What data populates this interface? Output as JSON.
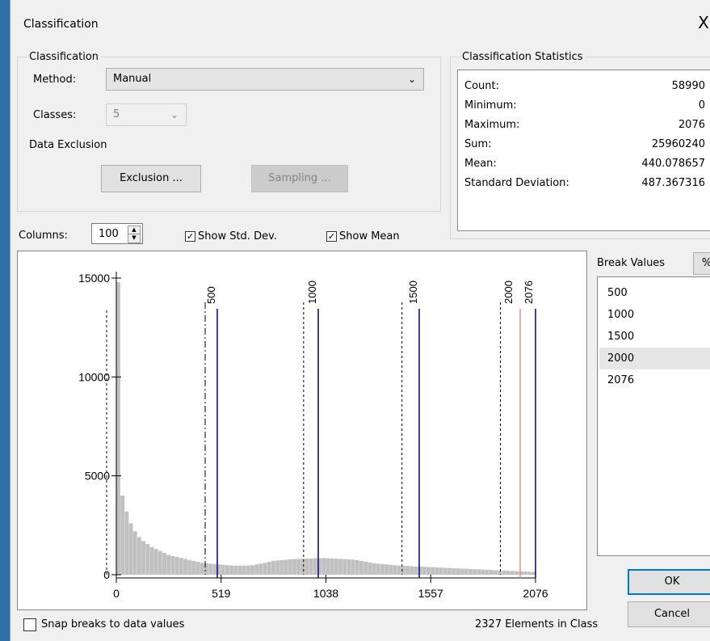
{
  "window": {
    "title": "Classification",
    "close_glyph": "X"
  },
  "classification": {
    "legend": "Classification",
    "method_label": "Method:",
    "method_value": "Manual",
    "classes_label": "Classes:",
    "classes_value": "5"
  },
  "data_exclusion": {
    "legend": "Data Exclusion",
    "exclusion_button": "Exclusion ...",
    "sampling_button": "Sampling ..."
  },
  "stats": {
    "legend": "Classification Statistics",
    "rows": [
      {
        "label": "Count:",
        "value": "58990"
      },
      {
        "label": "Minimum:",
        "value": "0"
      },
      {
        "label": "Maximum:",
        "value": "2076"
      },
      {
        "label": "Sum:",
        "value": "25960240"
      },
      {
        "label": "Mean:",
        "value": "440.078657"
      },
      {
        "label": "Standard Deviation:",
        "value": "487.367316"
      }
    ]
  },
  "controls": {
    "columns_label": "Columns:",
    "columns_value": "100",
    "show_std_dev_label": "Show Std. Dev.",
    "show_std_dev_checked": true,
    "show_mean_label": "Show Mean",
    "show_mean_checked": true
  },
  "break_values": {
    "header": "Break Values",
    "percent_button": "%",
    "items": [
      "500",
      "1000",
      "1500",
      "2000",
      "2076"
    ],
    "selected_index": 3
  },
  "buttons": {
    "ok": "OK",
    "cancel": "Cancel"
  },
  "footer": {
    "snap_label": "Snap breaks to data values",
    "snap_checked": false,
    "elements_text": "2327 Elements in Class"
  },
  "chart_data": {
    "type": "bar",
    "title": "",
    "xlabel": "",
    "ylabel": "",
    "xlim": [
      0,
      2076
    ],
    "ylim": [
      0,
      15000
    ],
    "x_ticks": [
      "0",
      "519",
      "1038",
      "1557",
      "2076"
    ],
    "y_ticks": [
      "0",
      "5000",
      "10000",
      "15000"
    ],
    "bin_count": 100,
    "histogram_counts": [
      14800,
      4000,
      3200,
      2600,
      2200,
      1900,
      1700,
      1550,
      1400,
      1300,
      1200,
      1100,
      1000,
      950,
      900,
      850,
      800,
      750,
      700,
      650,
      600,
      580,
      560,
      540,
      520,
      500,
      480,
      470,
      460,
      460,
      460,
      460,
      480,
      520,
      560,
      600,
      650,
      700,
      720,
      740,
      760,
      780,
      790,
      800,
      810,
      820,
      820,
      830,
      830,
      840,
      830,
      820,
      810,
      800,
      790,
      780,
      760,
      740,
      700,
      660,
      620,
      580,
      560,
      540,
      520,
      500,
      480,
      460,
      450,
      440,
      430,
      420,
      410,
      400,
      390,
      380,
      370,
      360,
      350,
      340,
      330,
      320,
      310,
      300,
      290,
      280,
      270,
      260,
      250,
      240,
      230,
      220,
      210,
      200,
      190,
      180,
      170,
      160,
      150,
      140
    ],
    "break_values": [
      500,
      1000,
      1500,
      2000,
      2076
    ],
    "break_color": "#000080",
    "selected_break_color": "#e8948a",
    "mean": 440.078657,
    "std_dev": 487.367316,
    "bar_color": "#c0c0c0"
  }
}
